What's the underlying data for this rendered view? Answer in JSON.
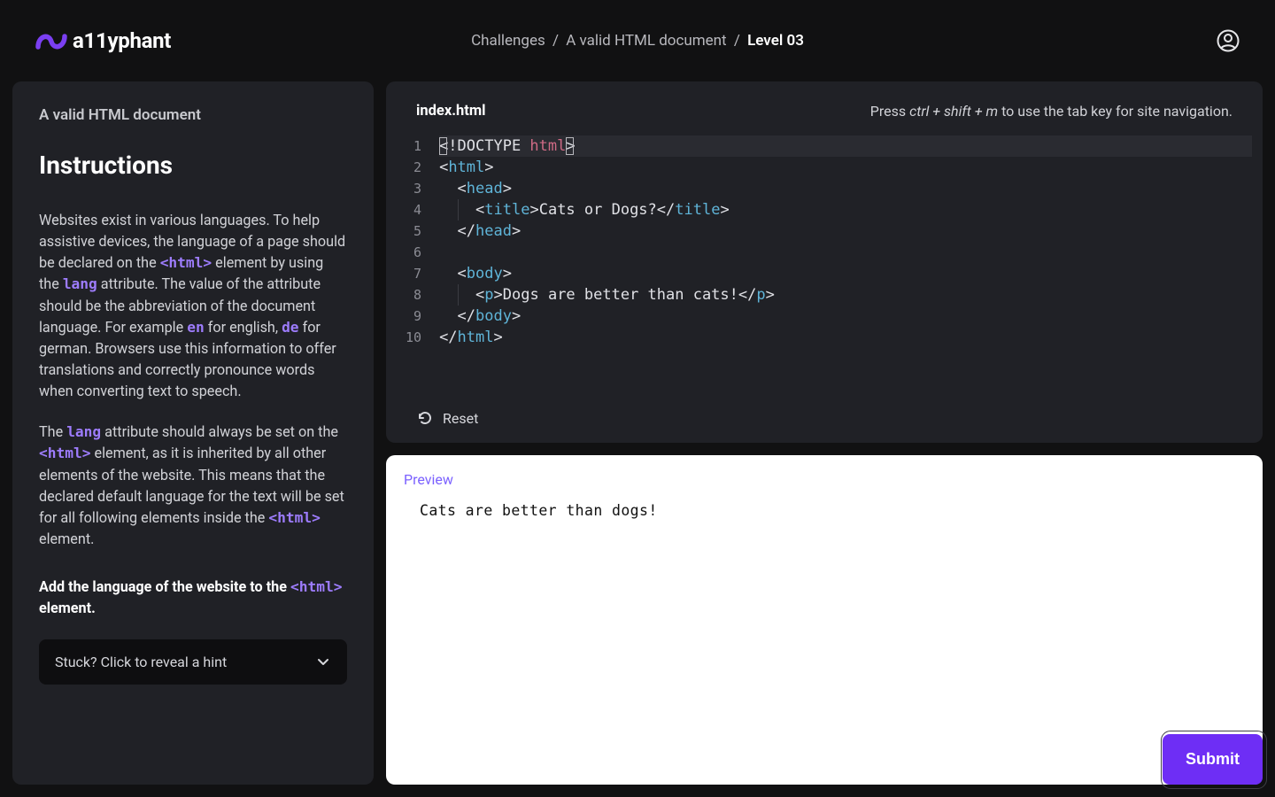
{
  "brand": {
    "name": "a11yphant"
  },
  "breadcrumb": {
    "root": "Challenges",
    "challenge": "A valid HTML document",
    "level": "Level 03"
  },
  "sidebar": {
    "challenge_title": "A valid HTML document",
    "heading": "Instructions",
    "para1_a": "Websites exist in various languages. To help assistive devices, the language of a page should be declared on the ",
    "para1_code1": "<html>",
    "para1_b": " element by using the ",
    "para1_code2": "lang",
    "para1_c": " attribute. The value of the attribute should be the abbreviation of the document language. For example ",
    "para1_code3": "en",
    "para1_d": " for english, ",
    "para1_code4": "de",
    "para1_e": " for german. Browsers use this information to offer translations and correctly pronounce words when converting text to speech.",
    "para2_a": "The ",
    "para2_code1": "lang",
    "para2_b": " attribute should always be set on the ",
    "para2_code2": "<html>",
    "para2_c": " element, as it is inherited by all other elements of the website. This means that the declared default language for the text will be set for all following elements inside the ",
    "para2_code3": "<html>",
    "para2_d": " element.",
    "task_a": "Add the language of the website to the ",
    "task_code": "<html>",
    "task_b": " element.",
    "hint_label": "Stuck? Click to reveal a hint"
  },
  "editor": {
    "filename": "index.html",
    "kb_hint_a": "Press ",
    "kb_hint_kb": "ctrl + shift + m",
    "kb_hint_b": " to use the tab key for site navigation.",
    "reset_label": "Reset",
    "code": {
      "l1": {
        "pre": "<!DOCTYPE ",
        "attr": "html",
        "post": ">"
      },
      "l2": {
        "open": "<",
        "tag": "html",
        "close": ">"
      },
      "l3": {
        "open": "<",
        "tag": "head",
        "close": ">"
      },
      "l4": {
        "open": "<",
        "tag1": "title",
        "mid": ">",
        "text": "Cats or Dogs?",
        "open2": "</",
        "tag2": "title",
        "close": ">"
      },
      "l5": {
        "open": "</",
        "tag": "head",
        "close": ">"
      },
      "l7": {
        "open": "<",
        "tag": "body",
        "close": ">"
      },
      "l8": {
        "open": "<",
        "tag1": "p",
        "mid": ">",
        "text": "Dogs are better than cats!",
        "open2": "</",
        "tag2": "p",
        "close": ">"
      },
      "l9": {
        "open": "</",
        "tag": "body",
        "close": ">"
      },
      "l10": {
        "open": "</",
        "tag": "html",
        "close": ">"
      }
    }
  },
  "preview": {
    "label": "Preview",
    "content": "Cats are better than dogs!"
  },
  "submit": {
    "label": "Submit"
  }
}
